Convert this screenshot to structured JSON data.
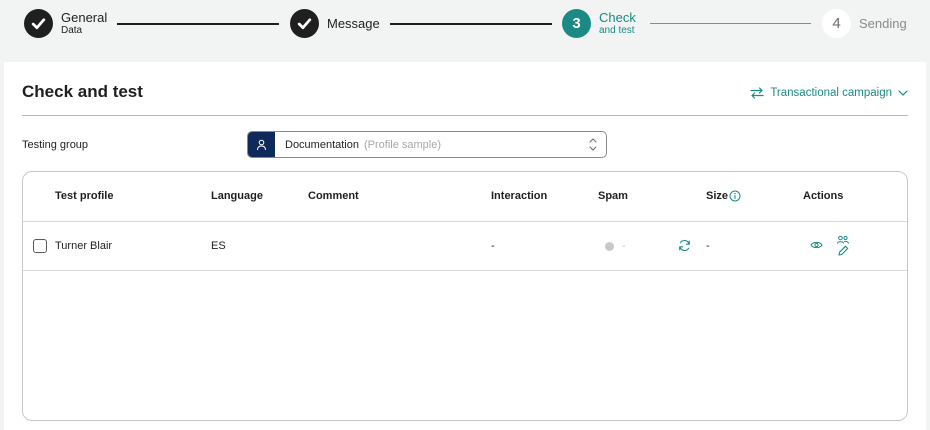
{
  "stepper": {
    "steps": [
      {
        "number": "",
        "title": "General",
        "subtitle": "Data",
        "state": "done"
      },
      {
        "number": "",
        "title": "Message",
        "subtitle": "",
        "state": "done"
      },
      {
        "number": "3",
        "title": "Check",
        "subtitle": "and test",
        "state": "active"
      },
      {
        "number": "4",
        "title": "Sending",
        "subtitle": "",
        "state": "todo"
      }
    ]
  },
  "card": {
    "title": "Check and test",
    "campaign_type": "Transactional campaign"
  },
  "testing_group": {
    "label": "Testing group",
    "selected": "Documentation",
    "hint": "(Profile sample)"
  },
  "table": {
    "headers": {
      "test_profile": "Test profile",
      "language": "Language",
      "comment": "Comment",
      "interaction": "Interaction",
      "spam": "Spam",
      "size": "Size",
      "actions": "Actions"
    },
    "rows": [
      {
        "profile": "Turner Blair",
        "language": "ES",
        "comment": "",
        "interaction": "-",
        "spam": "-",
        "size": "-"
      }
    ]
  },
  "colors": {
    "accent": "#1b8a84",
    "navy": "#0f2a5a",
    "dark": "#1f1f1f"
  },
  "icons": {
    "done": "check-icon",
    "campaign": "swap-arrows-icon",
    "dropdown": "chevron-down-icon",
    "group": "person-icon",
    "select": "up-down-chevron-icon",
    "info": "info-icon",
    "refresh": "refresh-icon",
    "preview": "eye-icon",
    "edit_profile": "edit-users-icon"
  }
}
